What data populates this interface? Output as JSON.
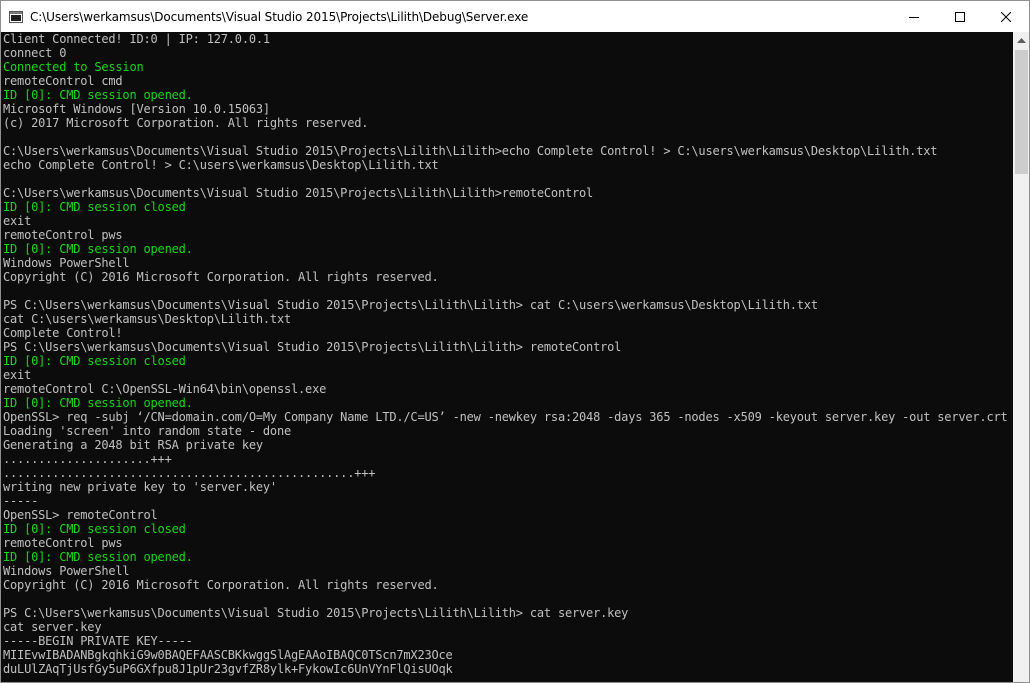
{
  "window": {
    "title": "C:\\Users\\werkamsus\\Documents\\Visual Studio 2015\\Projects\\Lilith\\Debug\\Server.exe",
    "app_icon": "console-app-icon",
    "controls": {
      "minimize_icon": "minimize-icon",
      "maximize_icon": "maximize-icon",
      "close_icon": "close-icon"
    }
  },
  "colors": {
    "console_background": "#0c0c0c",
    "console_text": "#c0c0c0",
    "console_text_green": "#13d813"
  },
  "console": {
    "lines": [
      {
        "text": "Client Connected! ID:0 | IP: 127.0.0.1",
        "style": "normal"
      },
      {
        "text": "connect 0",
        "style": "normal"
      },
      {
        "text": "Connected to Session",
        "style": "green"
      },
      {
        "text": "remoteControl cmd",
        "style": "normal"
      },
      {
        "text": "ID [0]: CMD session opened.",
        "style": "green"
      },
      {
        "text": "Microsoft Windows [Version 10.0.15063]",
        "style": "normal"
      },
      {
        "text": "(c) 2017 Microsoft Corporation. All rights reserved.",
        "style": "normal"
      },
      {
        "text": "",
        "style": "normal"
      },
      {
        "text": "C:\\Users\\werkamsus\\Documents\\Visual Studio 2015\\Projects\\Lilith\\Lilith>echo Complete Control! > C:\\users\\werkamsus\\Desktop\\Lilith.txt",
        "style": "normal"
      },
      {
        "text": "echo Complete Control! > C:\\users\\werkamsus\\Desktop\\Lilith.txt",
        "style": "normal"
      },
      {
        "text": "",
        "style": "normal"
      },
      {
        "text": "C:\\Users\\werkamsus\\Documents\\Visual Studio 2015\\Projects\\Lilith\\Lilith>remoteControl",
        "style": "normal"
      },
      {
        "text": "ID [0]: CMD session closed",
        "style": "green"
      },
      {
        "text": "exit",
        "style": "normal"
      },
      {
        "text": "remoteControl pws",
        "style": "normal"
      },
      {
        "text": "ID [0]: CMD session opened.",
        "style": "green"
      },
      {
        "text": "Windows PowerShell",
        "style": "normal"
      },
      {
        "text": "Copyright (C) 2016 Microsoft Corporation. All rights reserved.",
        "style": "normal"
      },
      {
        "text": "",
        "style": "normal"
      },
      {
        "text": "PS C:\\Users\\werkamsus\\Documents\\Visual Studio 2015\\Projects\\Lilith\\Lilith> cat C:\\users\\werkamsus\\Desktop\\Lilith.txt",
        "style": "normal"
      },
      {
        "text": "cat C:\\users\\werkamsus\\Desktop\\Lilith.txt",
        "style": "normal"
      },
      {
        "text": "Complete Control!",
        "style": "normal"
      },
      {
        "text": "PS C:\\Users\\werkamsus\\Documents\\Visual Studio 2015\\Projects\\Lilith\\Lilith> remoteControl",
        "style": "normal"
      },
      {
        "text": "ID [0]: CMD session closed",
        "style": "green"
      },
      {
        "text": "exit",
        "style": "normal"
      },
      {
        "text": "remoteControl C:\\OpenSSL-Win64\\bin\\openssl.exe",
        "style": "normal"
      },
      {
        "text": "ID [0]: CMD session opened.",
        "style": "green"
      },
      {
        "text": "OpenSSL> req -subj ‘/CN=domain.com/O=My Company Name LTD./C=US’ -new -newkey rsa:2048 -days 365 -nodes -x509 -keyout server.key -out server.crt",
        "style": "normal"
      },
      {
        "text": "Loading 'screen' into random state - done",
        "style": "normal"
      },
      {
        "text": "Generating a 2048 bit RSA private key",
        "style": "normal"
      },
      {
        "text": ".....................+++",
        "style": "normal"
      },
      {
        "text": "..................................................+++",
        "style": "normal"
      },
      {
        "text": "writing new private key to 'server.key'",
        "style": "normal"
      },
      {
        "text": "-----",
        "style": "normal"
      },
      {
        "text": "OpenSSL> remoteControl",
        "style": "normal"
      },
      {
        "text": "ID [0]: CMD session closed",
        "style": "green"
      },
      {
        "text": "remoteControl pws",
        "style": "normal"
      },
      {
        "text": "ID [0]: CMD session opened.",
        "style": "green"
      },
      {
        "text": "Windows PowerShell",
        "style": "normal"
      },
      {
        "text": "Copyright (C) 2016 Microsoft Corporation. All rights reserved.",
        "style": "normal"
      },
      {
        "text": "",
        "style": "normal"
      },
      {
        "text": "PS C:\\Users\\werkamsus\\Documents\\Visual Studio 2015\\Projects\\Lilith\\Lilith> cat server.key",
        "style": "normal"
      },
      {
        "text": "cat server.key",
        "style": "normal"
      },
      {
        "text": "-----BEGIN PRIVATE KEY-----",
        "style": "normal"
      },
      {
        "text": "MIIEvwIBADANBgkqhkiG9w0BAQEFAASCBKkwggSlAgEAAoIBAQC0TScn7mX23Oce",
        "style": "normal"
      },
      {
        "text": "duLUlZAqTjUsfGy5uP6GXfpu8J1pUr23gvfZR8ylk+FykowIc6UnVYnFlQisUOqk",
        "style": "normal"
      }
    ]
  },
  "scrollbar": {
    "up_icon": "scroll-up-arrow-icon"
  }
}
